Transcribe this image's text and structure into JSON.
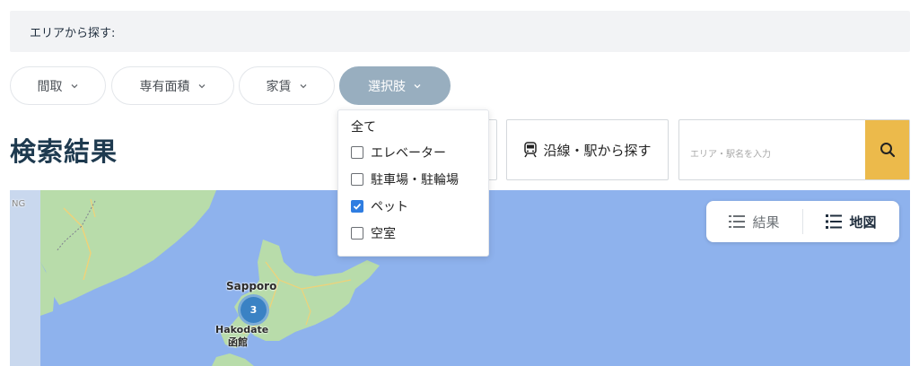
{
  "area_bar": {
    "label": "エリアから探す:"
  },
  "filters": [
    {
      "label": "間取"
    },
    {
      "label": "専有面積"
    },
    {
      "label": "家賃"
    },
    {
      "label": "選択肢"
    }
  ],
  "results_title": "検索結果",
  "dropdown": {
    "all_label": "全て",
    "options": [
      {
        "label": "エレベーター",
        "checked": false
      },
      {
        "label": "駐車場・駐輪場",
        "checked": false
      },
      {
        "label": "ペット",
        "checked": true
      },
      {
        "label": "空室",
        "checked": false
      }
    ]
  },
  "station_search": {
    "label": "沿線・駅から探す",
    "icon": "train-icon"
  },
  "area_search": {
    "placeholder": "エリア・駅名を入力",
    "icon": "search-icon"
  },
  "view_toggle": {
    "list_label": "結果",
    "map_label": "地図"
  },
  "map": {
    "city_sapporo": "Sapporo",
    "city_hakodate": "Hakodate",
    "city_hakodate_jp": "函館",
    "edge_label": "NG",
    "cluster_count": "3"
  },
  "colors": {
    "accent_yellow": "#ecba4b",
    "active_pill": "#98aebf",
    "checkbox_blue": "#2f7de1",
    "title": "#1e3a4f",
    "water": "#8eb2ed",
    "land": "#b8dcaa",
    "cluster": "#3a82c4"
  }
}
